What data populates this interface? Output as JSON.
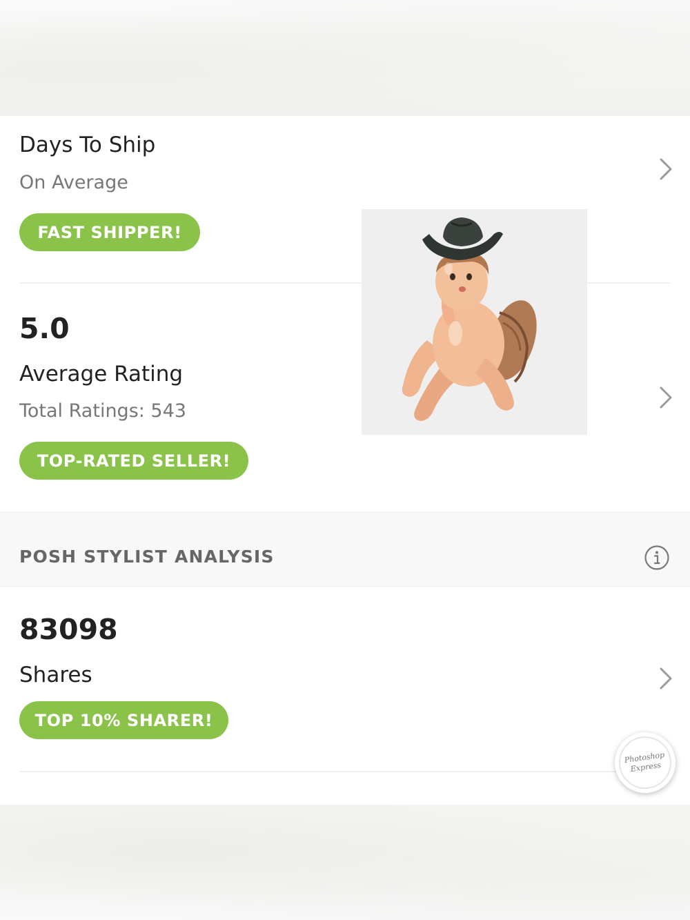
{
  "shipping": {
    "title": "Days To Ship",
    "subtitle": "On Average",
    "badge": "FAST SHIPPER!"
  },
  "rating": {
    "value": "5.0",
    "title": "Average Rating",
    "total": "Total Ratings: 543",
    "badge": "TOP-RATED SELLER!"
  },
  "analysis": {
    "section_label": "POSH STYLIST ANALYSIS",
    "info_icon": "info-circle-icon"
  },
  "shares": {
    "value": "83098",
    "title": "Shares",
    "badge": "TOP 10% SHARER!"
  },
  "stamp": {
    "line1": "Photoshop",
    "line2": "Express"
  },
  "colors": {
    "badge_green": "#8bc34a",
    "chevron": "#9a9a9a",
    "section_band": "#f8f8f8"
  },
  "icons": {
    "chevron": "chevron-right-icon"
  }
}
